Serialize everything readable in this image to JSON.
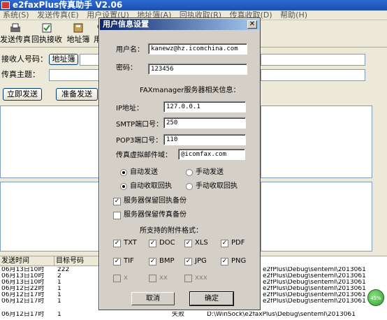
{
  "main": {
    "title": "e2faxPlus传真助手 V2.06",
    "menu": [
      "系统(S)",
      "发送传真(E)",
      "用户设置(U)",
      "地址簿(A)",
      "回执收取(R)",
      "传真收取(D)",
      "帮助(H)"
    ],
    "toolbar": [
      "发送传真",
      "回执接收",
      "地址簿",
      "用"
    ],
    "recipient_label": "接收人号码：",
    "address_book_button": "地址簿",
    "subject_label": "传真主题：",
    "send_now_button": "立即发送",
    "prepare_send_button": "准备发送",
    "grid": {
      "headers": [
        "发送时间",
        "目标号码"
      ],
      "rows": [
        {
          "time": "06月13日10时",
          "number": "222",
          "status": "",
          "path": "e2fPlus\\Debug\\senteml\\2013061"
        },
        {
          "time": "06月13日10时",
          "number": "2",
          "status": "",
          "path": "e2fPlus\\Debug\\senteml\\2013061"
        },
        {
          "time": "06月13日10时",
          "number": "1",
          "status": "",
          "path": "e2fPlus\\Debug\\senteml\\2013061"
        },
        {
          "time": "06月12日22时",
          "number": "1",
          "status": "",
          "path": "e2fPlus\\Debug\\senteml\\2013061"
        },
        {
          "time": "06月12日17时",
          "number": "1",
          "status": "",
          "path": "e2fPlus\\Debug\\senteml\\2013061"
        },
        {
          "time": "06月12日17时",
          "number": "1",
          "status": "",
          "path": "e2fPlus\\Debug\\senteml\\2013061"
        },
        {
          "time": "06月12日17时",
          "number": "1",
          "status": "失败",
          "path": "D:\\WinSock\\e2faxPlus\\Debug\\senteml\\2013061"
        }
      ]
    },
    "badge": "45%"
  },
  "dialog": {
    "title": "用户信息设置",
    "username_label": "用户名：",
    "username": "kanewz@hz.icomchina.com",
    "password_label": "密码：",
    "password": "123456",
    "section_title": "FAXmanager服务器相关信息：",
    "ip_label": "IP地址：",
    "ip": "127.0.0.1",
    "smtp_label": "SMTP端口号：",
    "smtp": "250",
    "pop3_label": "POP3端口号：",
    "pop3": "110",
    "domain_label": "传真虚拟邮件域：",
    "domain": "@icomfax.com",
    "radio_auto_send": "自动发送",
    "radio_manual_send": "手动发送",
    "radio_auto_receipt": "自动收取回执",
    "radio_manual_receipt": "手动收取回执",
    "chk_keep_receipt": "服务器保留回执备份",
    "chk_keep_fax": "服务器保留传真备份",
    "formats_title": "所支持的附件格式：",
    "formats": [
      {
        "label": "TXT",
        "checked": true
      },
      {
        "label": "DOC",
        "checked": true
      },
      {
        "label": "XLS",
        "checked": true
      },
      {
        "label": "PDF",
        "checked": true
      },
      {
        "label": "TIF",
        "checked": true
      },
      {
        "label": "BMP",
        "checked": true
      },
      {
        "label": "JPG",
        "checked": true
      },
      {
        "label": "PNG",
        "checked": true
      },
      {
        "label": "x",
        "checked": false
      },
      {
        "label": "xx",
        "checked": false
      },
      {
        "label": "xxx",
        "checked": false
      }
    ],
    "cancel_button": "取消",
    "ok_button": "确定"
  }
}
